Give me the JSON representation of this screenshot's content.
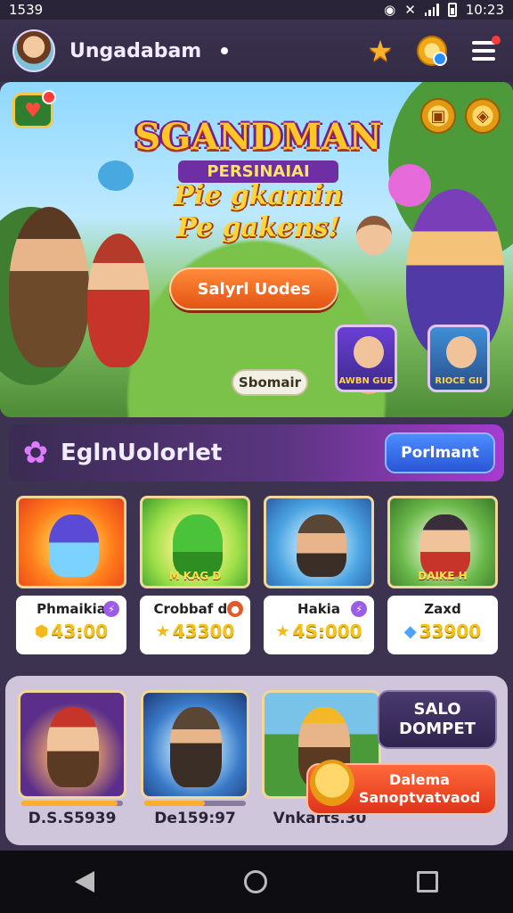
{
  "status_bar": {
    "left_text": "1539",
    "time": "10:23"
  },
  "header": {
    "username": "Ungadabam"
  },
  "hero": {
    "title": "SGANDMAN",
    "subtitle": "PERSINAIAI",
    "tagline_1": "Pie gkamin",
    "tagline_2": "Pe gakens!",
    "cta_label": "Salyrl Uodes",
    "secondary_label": "Sbomair",
    "mini_card_1_label": "AWBN GUE",
    "mini_card_2_label": "RIOCE GII"
  },
  "section": {
    "title": "EglnUolorlet",
    "button_label": "Porlmant"
  },
  "games": [
    {
      "name": "Phmaikia",
      "price": "43:00",
      "price_icon": "coin-icon",
      "thumb_label": "",
      "badge_color": "#9b5de5"
    },
    {
      "name": "Crobbaf do",
      "price": "43300",
      "price_icon": "star-icon",
      "thumb_label": "M KAG D",
      "badge_color": "#e05a2a"
    },
    {
      "name": "Hakia",
      "price": "4S:000",
      "price_icon": "star-icon",
      "thumb_label": "",
      "badge_color": "#9b5de5"
    },
    {
      "name": "Zaxd",
      "price": "33900",
      "price_icon": "gem-icon",
      "thumb_label": "DAIKE H",
      "badge_color": "#ffffff"
    }
  ],
  "promos": [
    {
      "caption": "D.S.S5939",
      "progress": 0.95
    },
    {
      "caption": "De159:97",
      "progress": 0.6
    },
    {
      "caption": "Vnkarts.30"
    }
  ],
  "wallet": {
    "line1": "SALO",
    "line2": "DOMPET"
  },
  "offer": {
    "line1": "Dalema",
    "line2": "Sanoptvatvaod"
  }
}
